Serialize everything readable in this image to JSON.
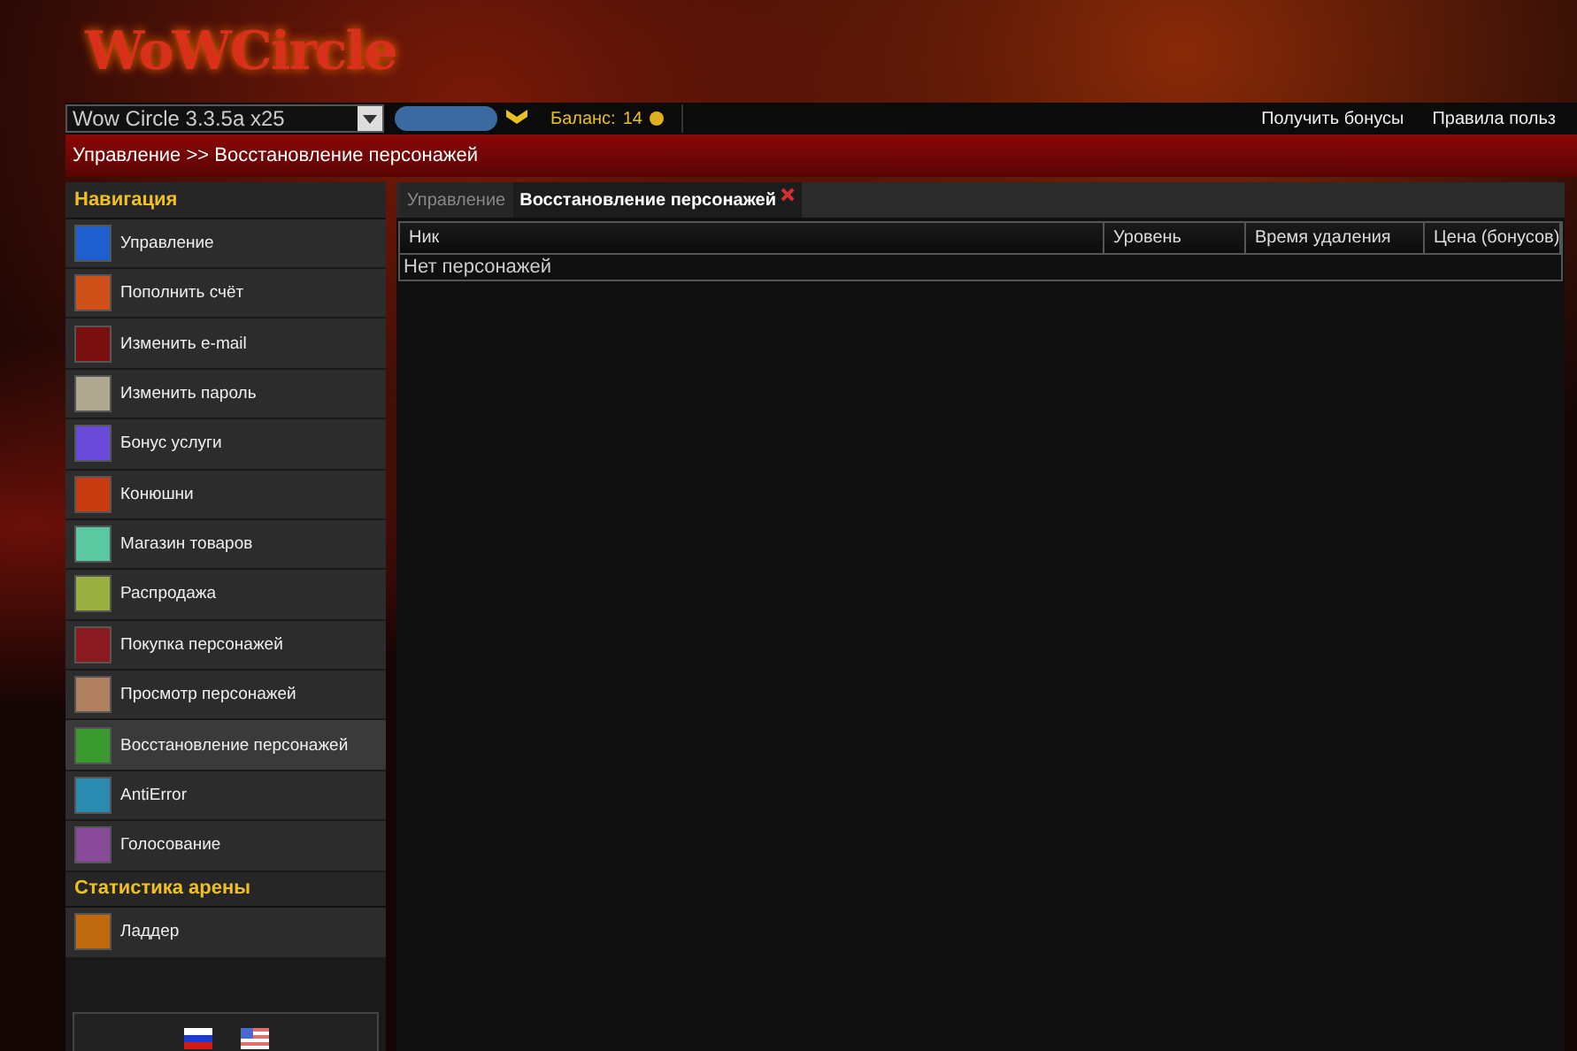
{
  "logo": "WoWCircle",
  "topbar": {
    "realm_select": "Wow Circle 3.3.5a x25",
    "balance_label": "Баланс:",
    "balance_value": "14",
    "links": [
      "Получить бонусы",
      "Правила польз"
    ]
  },
  "breadcrumb": "Управление >> Восстановление персонажей",
  "sidebar": {
    "sections": [
      {
        "title": "Навигация",
        "items": [
          {
            "label": "Управление",
            "selected": false
          },
          {
            "label": "Пополнить счёт",
            "selected": false
          },
          {
            "label": "Изменить e-mail",
            "selected": false
          },
          {
            "label": "Изменить пароль",
            "selected": false
          },
          {
            "label": "Бонус услуги",
            "selected": false
          },
          {
            "label": "Конюшни",
            "selected": false
          },
          {
            "label": "Магазин товаров",
            "selected": false
          },
          {
            "label": "Распродажа",
            "selected": false
          },
          {
            "label": "Покупка персонажей",
            "selected": false
          },
          {
            "label": "Просмотр персонажей",
            "selected": false
          },
          {
            "label": "Восстановление персонажей",
            "selected": true
          },
          {
            "label": "AntiError",
            "selected": false
          },
          {
            "label": "Голосование",
            "selected": false
          }
        ]
      },
      {
        "title": "Статистика арены",
        "items": [
          {
            "label": "Ладдер",
            "selected": false
          }
        ]
      }
    ]
  },
  "tabs": [
    {
      "label": "Управление",
      "selected": false
    },
    {
      "label": "Восстановление персонажей",
      "selected": true
    }
  ],
  "table": {
    "columns": [
      "Ник",
      "Уровень",
      "Время удаления",
      "Цена (бонусов)"
    ],
    "empty_text": "Нет персонажей"
  }
}
